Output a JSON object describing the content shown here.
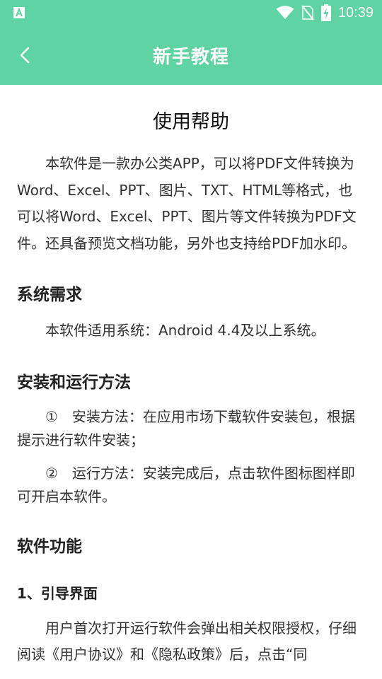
{
  "status_bar": {
    "time": "10:39"
  },
  "app_bar": {
    "title": "新手教程"
  },
  "document": {
    "title": "使用帮助",
    "intro": "本软件是一款办公类APP，可以将PDF文件转换为Word、Excel、PPT、图片、TXT、HTML等格式，也可以将Word、Excel、PPT、图片等文件转换为PDF文件。还具备预览文档功能，另外也支持给PDF加水印。",
    "section_requirements": {
      "heading": "系统需求",
      "text": "本软件适用系统：Android 4.4及以上系统。"
    },
    "section_install": {
      "heading": "安装和运行方法",
      "step1": "①　安装方法：在应用市场下载软件安装包，根据提示进行软件安装；",
      "step2": "②　运行方法：安装完成后，点击软件图标图样即可开启本软件。"
    },
    "section_features": {
      "heading": "软件功能",
      "sub1_heading": "1、引导界面",
      "sub1_text": "用户首次打开运行软件会弹出相关权限授权，仔细阅读《用户协议》和《隐私政策》后，点击“同"
    }
  },
  "colors": {
    "accent": "#5fd3a3"
  },
  "icons": [
    "app-notification-icon",
    "wifi-icon",
    "no-sim-icon",
    "battery-charging-icon",
    "back-arrow-icon"
  ]
}
